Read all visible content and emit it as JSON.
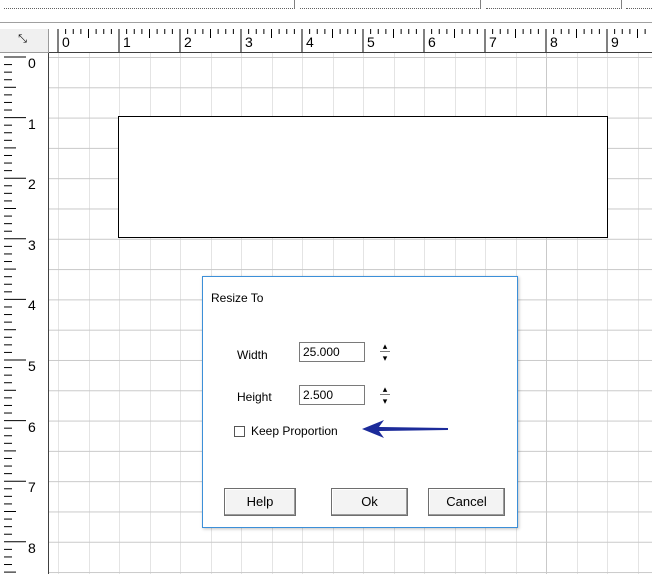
{
  "ruler": {
    "horizontal": [
      "0",
      "1",
      "2",
      "3",
      "4",
      "5",
      "6",
      "7",
      "8",
      "9"
    ],
    "vertical": [
      "0",
      "1",
      "2",
      "3",
      "4",
      "5",
      "6",
      "7",
      "8"
    ]
  },
  "dialog": {
    "title": "Resize To",
    "width_label": "Width",
    "width_value": "25.000",
    "height_label": "Height",
    "height_value": "2.500",
    "keep_proportion_label": "Keep Proportion",
    "keep_proportion_checked": false,
    "help_label": "Help",
    "ok_label": "Ok",
    "cancel_label": "Cancel"
  },
  "colors": {
    "dialog_border": "#3c8fd8",
    "arrow": "#1c2b9a",
    "grid": "#c9c9c9"
  },
  "icons": {
    "corner": "ruler-corner-icon",
    "pointer": "arrow-pointer-icon"
  }
}
